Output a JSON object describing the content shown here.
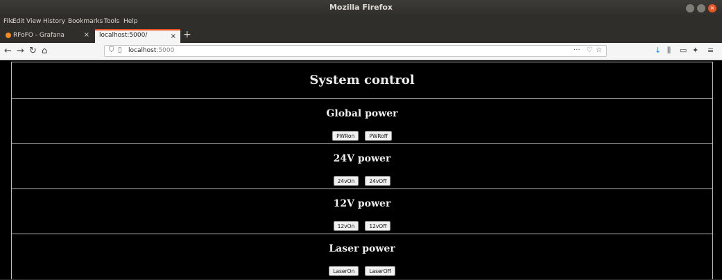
{
  "window": {
    "title": "Mozilla Firefox"
  },
  "menu": [
    "File",
    "Edit",
    "View",
    "History",
    "Bookmarks",
    "Tools",
    "Help"
  ],
  "tabs": [
    {
      "label": "RFoFO - Grafana",
      "active": false
    },
    {
      "label": "localhost:5000/",
      "active": true
    }
  ],
  "address": {
    "host": "localhost",
    "port": ":5000"
  },
  "page": {
    "title": "System control",
    "sections": [
      {
        "heading": "Global power",
        "buttons": [
          "PWRon",
          "PWRoff"
        ]
      },
      {
        "heading": "24V power",
        "buttons": [
          "24vOn",
          "24vOff"
        ]
      },
      {
        "heading": "12V power",
        "buttons": [
          "12vOn",
          "12vOff"
        ]
      },
      {
        "heading": "Laser power",
        "buttons": [
          "LaserOn",
          "LaserOff"
        ]
      }
    ]
  },
  "colors": {
    "accent": "#e95420",
    "page_bg": "#000000",
    "text": "#eeeeee"
  }
}
